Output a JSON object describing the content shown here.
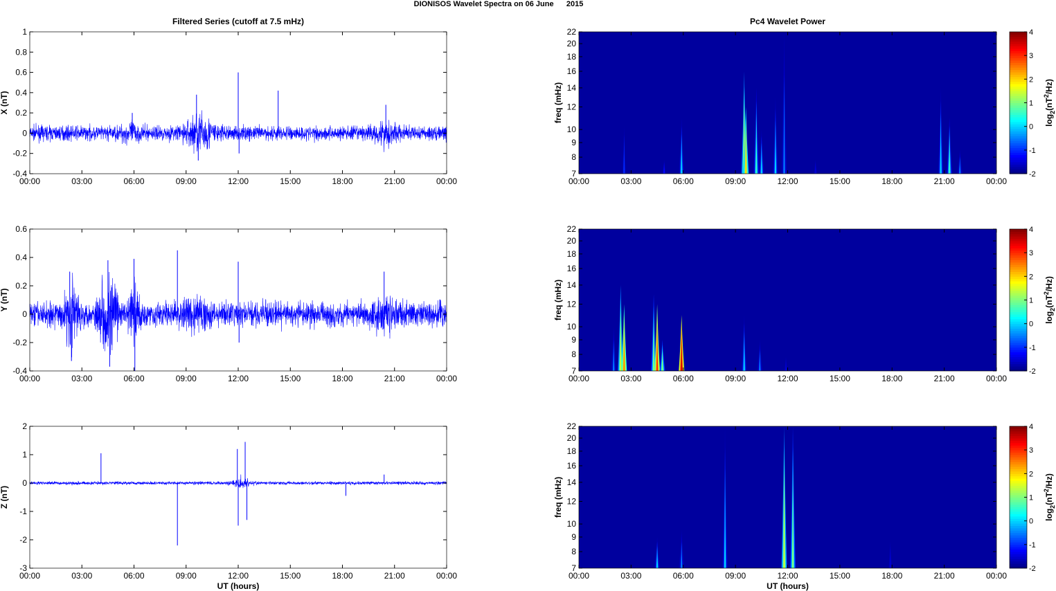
{
  "title": "DIONISOS Wavelet Spectra on 06 June      2015",
  "chart_data": [
    {
      "type": "line",
      "title": "Filtered Series (cutoff at 7.5 mHz)",
      "ylabel": "X (nT)",
      "xlabel": "",
      "ylim": [
        -0.4,
        1
      ],
      "yticks": [
        "-0.4",
        "-0.2",
        "0",
        "0.2",
        "0.4",
        "0.6",
        "0.8",
        "1"
      ],
      "yvals": [
        -0.4,
        -0.2,
        0,
        0.2,
        0.4,
        0.6,
        0.8,
        1
      ],
      "xticks": [
        "00:00",
        "03:00",
        "06:00",
        "09:00",
        "12:00",
        "15:00",
        "18:00",
        "21:00",
        "00:00"
      ],
      "xlim_hours": [
        0,
        24
      ],
      "noise": 0.05,
      "bursts": [
        [
          9.8,
          0.8,
          0.1
        ],
        [
          20.5,
          0.6,
          0.06
        ],
        [
          5.8,
          0.5,
          0.04
        ]
      ],
      "spikes": [
        [
          9.6,
          0.38
        ],
        [
          9.7,
          -0.27
        ],
        [
          12.0,
          0.6
        ],
        [
          12.05,
          -0.2
        ],
        [
          14.3,
          0.42
        ],
        [
          20.5,
          0.28
        ],
        [
          5.9,
          0.2
        ]
      ]
    },
    {
      "type": "line",
      "title": "",
      "ylabel": "Y (nT)",
      "xlabel": "",
      "ylim": [
        -0.4,
        0.6
      ],
      "yticks": [
        "-0.4",
        "-0.2",
        "0",
        "0.2",
        "0.4",
        "0.6"
      ],
      "yvals": [
        -0.4,
        -0.2,
        0,
        0.2,
        0.4,
        0.6
      ],
      "xticks": [
        "00:00",
        "03:00",
        "06:00",
        "09:00",
        "12:00",
        "15:00",
        "18:00",
        "21:00",
        "00:00"
      ],
      "xlim_hours": [
        0,
        24
      ],
      "noise": 0.06,
      "bursts": [
        [
          2.4,
          0.4,
          0.12
        ],
        [
          4.5,
          0.5,
          0.16
        ],
        [
          6.0,
          0.3,
          0.14
        ],
        [
          9.5,
          0.6,
          0.05
        ],
        [
          20.4,
          0.6,
          0.05
        ]
      ],
      "spikes": [
        [
          2.3,
          0.3
        ],
        [
          2.4,
          -0.33
        ],
        [
          4.5,
          0.38
        ],
        [
          4.6,
          -0.37
        ],
        [
          6.0,
          0.39
        ],
        [
          6.05,
          -0.4
        ],
        [
          8.5,
          0.45
        ],
        [
          12.0,
          0.37
        ],
        [
          12.05,
          -0.2
        ],
        [
          20.4,
          0.3
        ]
      ]
    },
    {
      "type": "line",
      "title": "",
      "ylabel": "Z (nT)",
      "xlabel": "UT (hours)",
      "ylim": [
        -3,
        2
      ],
      "yticks": [
        "-3",
        "-2",
        "-1",
        "0",
        "1",
        "2"
      ],
      "yvals": [
        -3,
        -2,
        -1,
        0,
        1,
        2
      ],
      "xticks": [
        "00:00",
        "03:00",
        "06:00",
        "09:00",
        "12:00",
        "15:00",
        "18:00",
        "21:00",
        "00:00"
      ],
      "xlim_hours": [
        0,
        24
      ],
      "noise": 0.04,
      "bursts": [
        [
          12.2,
          0.5,
          0.1
        ]
      ],
      "spikes": [
        [
          4.1,
          1.05
        ],
        [
          8.5,
          -2.2
        ],
        [
          11.95,
          1.2
        ],
        [
          12.0,
          -1.5
        ],
        [
          12.4,
          1.45
        ],
        [
          12.5,
          -1.3
        ],
        [
          18.2,
          -0.45
        ],
        [
          20.4,
          0.3
        ]
      ]
    },
    {
      "type": "heatmap",
      "title": "Pc4 Wavelet Power",
      "ylabel": "freq (mHz)",
      "xlabel": "",
      "yscale": "log",
      "ylim": [
        7,
        22
      ],
      "yticks": [
        "7",
        "8",
        "9",
        "10",
        "12",
        "14",
        "16",
        "18",
        "20",
        "22"
      ],
      "yvals": [
        7,
        8,
        9,
        10,
        12,
        14,
        16,
        18,
        20,
        22
      ],
      "xticks": [
        "00:00",
        "03:00",
        "06:00",
        "09:00",
        "12:00",
        "15:00",
        "18:00",
        "21:00",
        "00:00"
      ],
      "colorbar": {
        "label": "log2(nT²/Hz)",
        "range": [
          -2,
          4
        ],
        "ticks": [
          "-2",
          "-1",
          "0",
          "1",
          "2",
          "3",
          "4"
        ]
      },
      "events": [
        [
          2.6,
          11,
          -1
        ],
        [
          4.9,
          8,
          -1.2
        ],
        [
          5.9,
          11,
          0
        ],
        [
          9.5,
          16,
          1.5
        ],
        [
          9.6,
          12,
          2
        ],
        [
          10.2,
          14,
          0.5
        ],
        [
          10.5,
          10,
          0
        ],
        [
          11.3,
          13,
          0
        ],
        [
          11.8,
          22,
          -0.5
        ],
        [
          13.6,
          8,
          -1.5
        ],
        [
          20.8,
          14,
          0
        ],
        [
          21.3,
          11,
          0.5
        ],
        [
          21.9,
          8.5,
          -0.5
        ]
      ]
    },
    {
      "type": "heatmap",
      "title": "",
      "ylabel": "freq (mHz)",
      "xlabel": "",
      "yscale": "log",
      "ylim": [
        7,
        22
      ],
      "yticks": [
        "7",
        "8",
        "9",
        "10",
        "12",
        "14",
        "16",
        "18",
        "20",
        "22"
      ],
      "yvals": [
        7,
        8,
        9,
        10,
        12,
        14,
        16,
        18,
        20,
        22
      ],
      "xticks": [
        "00:00",
        "03:00",
        "06:00",
        "09:00",
        "12:00",
        "15:00",
        "18:00",
        "21:00",
        "00:00"
      ],
      "colorbar": {
        "label": "log2(nT²/Hz)",
        "range": [
          -2,
          4
        ],
        "ticks": [
          "-2",
          "-1",
          "0",
          "1",
          "2",
          "3",
          "4"
        ]
      },
      "events": [
        [
          2.0,
          10,
          -0.5
        ],
        [
          2.4,
          14,
          1.5
        ],
        [
          2.6,
          12,
          2.5
        ],
        [
          4.3,
          13,
          1
        ],
        [
          4.5,
          12,
          3
        ],
        [
          4.8,
          9,
          1
        ],
        [
          5.9,
          11,
          3.5
        ],
        [
          9.5,
          11,
          0
        ],
        [
          10.4,
          9,
          -0.5
        ],
        [
          11.9,
          8,
          -1.5
        ]
      ]
    },
    {
      "type": "heatmap",
      "title": "",
      "ylabel": "freq (mHz)",
      "xlabel": "UT (hours)",
      "yscale": "log",
      "ylim": [
        7,
        22
      ],
      "yticks": [
        "7",
        "8",
        "9",
        "10",
        "12",
        "14",
        "16",
        "18",
        "20",
        "22"
      ],
      "yvals": [
        7,
        8,
        9,
        10,
        12,
        14,
        16,
        18,
        20,
        22
      ],
      "xticks": [
        "00:00",
        "03:00",
        "06:00",
        "09:00",
        "12:00",
        "15:00",
        "18:00",
        "21:00",
        "00:00"
      ],
      "colorbar": {
        "label": "log2(nT²/Hz)",
        "range": [
          -2,
          4
        ],
        "ticks": [
          "-2",
          "-1",
          "0",
          "1",
          "2",
          "3",
          "4"
        ]
      },
      "events": [
        [
          4.5,
          9,
          0
        ],
        [
          5.9,
          9.5,
          -0.5
        ],
        [
          8.4,
          22,
          0
        ],
        [
          11.8,
          22,
          1.5
        ],
        [
          12.3,
          22,
          1
        ],
        [
          17.9,
          9,
          -1.5
        ]
      ]
    }
  ]
}
